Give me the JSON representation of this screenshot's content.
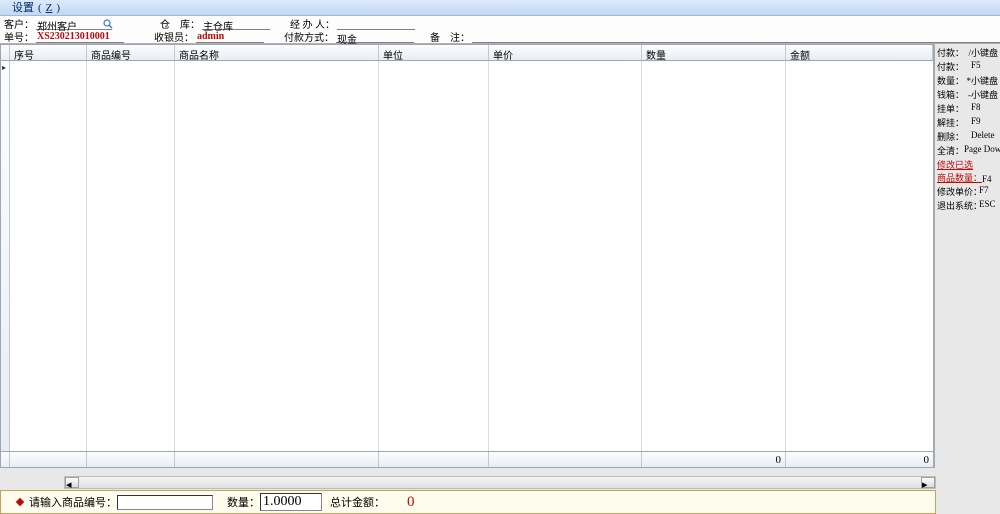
{
  "menu": {
    "settings": "设置",
    "settings_hotkey": "Z"
  },
  "header": {
    "customer_label": "客户：",
    "customer_value": "郑州客户",
    "order_label": "单号：",
    "order_value": "XS230213010001",
    "warehouse_label": "仓　库：",
    "warehouse_value": "主仓库",
    "cashier_label": "收银员：",
    "cashier_value": "admin",
    "handler_label": "经 办 人：",
    "handler_value": "",
    "paymethod_label": "付款方式：",
    "paymethod_value": "现金",
    "remark_label": "备　注：",
    "remark_value": ""
  },
  "columns": {
    "seq": "序号",
    "code": "商品编号",
    "name": "商品名称",
    "unit": "单位",
    "price": "单价",
    "qty": "数量",
    "amount": "金额"
  },
  "totals": {
    "qty": "0",
    "amount": "0"
  },
  "shortcuts": [
    {
      "label": "付款：",
      "key": "/小键盘"
    },
    {
      "label": "付款：",
      "key": "F5"
    },
    {
      "label": "数量：",
      "key": "*小键盘"
    },
    {
      "label": "钱箱：",
      "key": "-小键盘"
    },
    {
      "label": "挂单：",
      "key": "F8"
    },
    {
      "label": "解挂：",
      "key": "F9"
    },
    {
      "label": "删除：",
      "key": "Delete"
    },
    {
      "label": "全清：",
      "key": "Page Down"
    },
    {
      "label": "修改已选商品数量：",
      "key": "F4",
      "red": true,
      "twoLine": true
    },
    {
      "label": "修改单价：",
      "key": "F7"
    },
    {
      "label": "退出系统：",
      "key": "ESC"
    }
  ],
  "footer": {
    "prompt": "请输入商品编号：",
    "qty_label": "数量：",
    "qty_value": "1.0000",
    "total_label": "总计金额：",
    "total_value": "0"
  }
}
